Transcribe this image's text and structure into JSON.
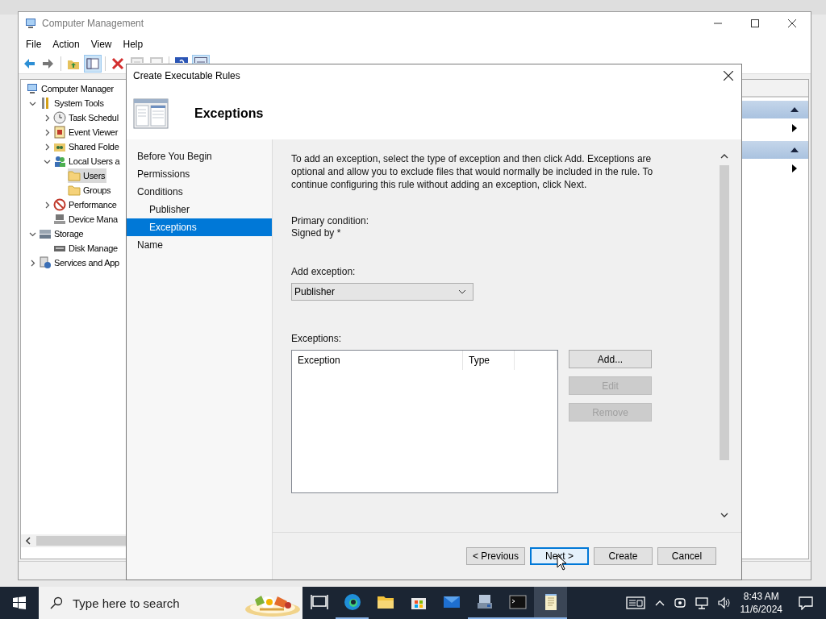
{
  "main_window": {
    "title": "Computer Management",
    "menu": [
      "File",
      "Action",
      "View",
      "Help"
    ],
    "toolbar": [
      {
        "kind": "back",
        "pressed": false,
        "disabled": false
      },
      {
        "kind": "forward",
        "pressed": false,
        "disabled": false
      },
      {
        "kind": "up",
        "pressed": false,
        "disabled": false
      },
      {
        "kind": "console",
        "pressed": true,
        "disabled": false
      },
      {
        "kind": "delete",
        "pressed": false,
        "disabled": false
      },
      {
        "kind": "properties",
        "pressed": false,
        "disabled": true
      },
      {
        "kind": "export",
        "pressed": false,
        "disabled": true
      },
      {
        "kind": "help",
        "pressed": false,
        "disabled": false
      },
      {
        "kind": "view",
        "pressed": true,
        "disabled": false
      }
    ],
    "tree": {
      "root": {
        "label": "Computer Manager",
        "kind": "computer",
        "selected": false
      },
      "items": [
        {
          "label": "System Tools",
          "kind": "tools",
          "selected": false,
          "expanded": true,
          "children": [
            {
              "label": "Task Schedul",
              "kind": "clock",
              "selected": false,
              "expanded": false
            },
            {
              "label": "Event Viewer",
              "kind": "event",
              "selected": false,
              "expanded": false
            },
            {
              "label": "Shared Folde",
              "kind": "share",
              "selected": false,
              "expanded": false
            },
            {
              "label": "Local Users a",
              "kind": "users",
              "selected": false,
              "expanded": true,
              "children": [
                {
                  "label": "Users",
                  "kind": "folder",
                  "selected": true
                },
                {
                  "label": "Groups",
                  "kind": "folder",
                  "selected": false
                }
              ]
            },
            {
              "label": "Performance",
              "kind": "perf",
              "selected": false,
              "expanded": false
            },
            {
              "label": "Device Mana",
              "kind": "device",
              "selected": false
            }
          ]
        },
        {
          "label": "Storage",
          "kind": "storage",
          "selected": false,
          "expanded": true,
          "children": [
            {
              "label": "Disk Manage",
              "kind": "disk",
              "selected": false
            }
          ]
        },
        {
          "label": "Services and App",
          "kind": "services",
          "selected": false,
          "expanded": false
        }
      ]
    }
  },
  "dialog": {
    "title": "Create Executable Rules",
    "heading": "Exceptions",
    "steps": [
      {
        "label": "Before You Begin",
        "selected": false
      },
      {
        "label": "Permissions",
        "selected": false
      },
      {
        "label": "Conditions",
        "selected": false,
        "children": [
          {
            "label": "Publisher",
            "selected": false
          },
          {
            "label": "Exceptions",
            "selected": true
          }
        ]
      },
      {
        "label": "Name",
        "selected": false
      }
    ],
    "intro": "To add an exception, select the type of exception and then click Add. Exceptions are optional and allow you to exclude files that would normally be included in the rule. To continue configuring this rule without adding an exception, click Next.",
    "primary_condition_label": "Primary condition:",
    "primary_condition": "Signed by *",
    "add_exception_label": "Add exception:",
    "add_exception": {
      "value": "Publisher"
    },
    "exceptions_label": "Exceptions:",
    "exceptions_columns": [
      "Exception",
      "Type"
    ],
    "side_buttons": [
      {
        "label": "Add...",
        "disabled": false
      },
      {
        "label": "Edit",
        "disabled": true
      },
      {
        "label": "Remove",
        "disabled": true
      }
    ],
    "footer_buttons": [
      {
        "label": "< Previous",
        "focused": false
      },
      {
        "label": "Next >",
        "focused": true
      },
      {
        "label": "Create",
        "focused": false
      },
      {
        "label": "Cancel",
        "focused": false
      }
    ]
  },
  "taskbar": {
    "search": {
      "placeholder": "Type here to search"
    },
    "apps": [
      {
        "kind": "taskview",
        "running": false,
        "selected": false
      },
      {
        "kind": "edge",
        "running": true,
        "selected": false
      },
      {
        "kind": "explorer",
        "running": false,
        "selected": false
      },
      {
        "kind": "store",
        "running": false,
        "selected": false
      },
      {
        "kind": "mail",
        "running": false,
        "selected": false
      },
      {
        "kind": "server",
        "running": true,
        "selected": false
      },
      {
        "kind": "terminal",
        "running": true,
        "selected": false
      },
      {
        "kind": "notepad",
        "running": true,
        "selected": true
      }
    ],
    "time": "8:43 AM",
    "date": "11/6/2024"
  }
}
